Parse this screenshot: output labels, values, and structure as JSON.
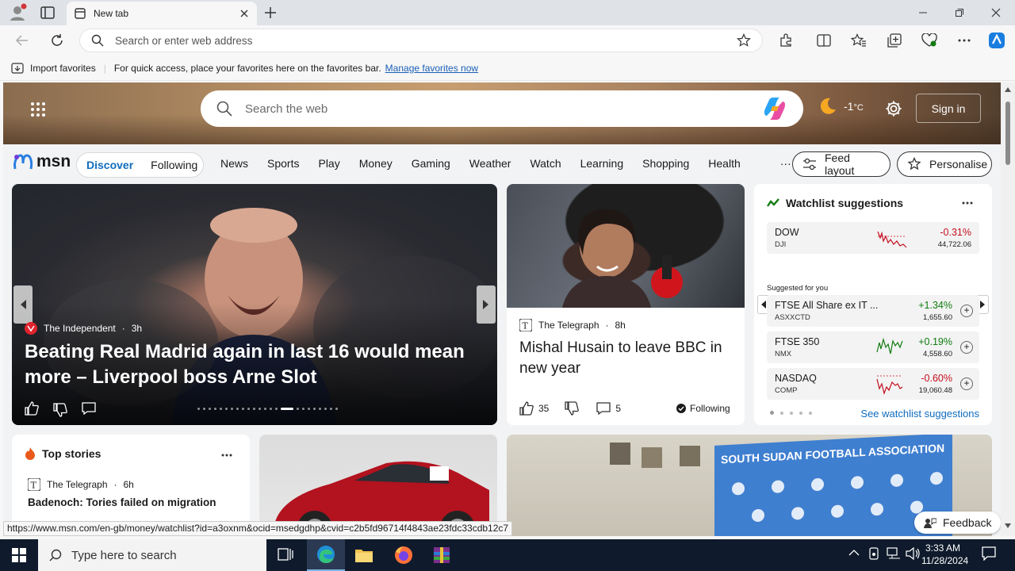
{
  "browser": {
    "tab_title": "New tab",
    "address_placeholder": "Search or enter web address",
    "favorites": {
      "import_label": "Import favorites",
      "hint_text": "For quick access, place your favorites here on the favorites bar.",
      "manage_link": "Manage favorites now"
    },
    "status_url": "https://www.msn.com/en-gb/money/watchlist?id=a3oxnm&ocid=msedgdhp&cvid=c2b5fd96714f4843ae23fdc33cdb12c7"
  },
  "msn": {
    "search_placeholder": "Search the web",
    "temperature": "-1",
    "temp_unit": "°C",
    "sign_in": "Sign in",
    "logo_text": "msn",
    "tabs": [
      "Discover",
      "Following"
    ],
    "nav": [
      "News",
      "Sports",
      "Play",
      "Money",
      "Gaming",
      "Weather",
      "Watch",
      "Learning",
      "Shopping",
      "Health"
    ],
    "more": "···",
    "feed_layout": "Feed layout",
    "personalise": "Personalise",
    "feedback": "Feedback"
  },
  "main_story": {
    "source": "The Independent",
    "age": "3h",
    "title": "Beating Real Madrid again in last 16 would mean more – Liverpool boss Arne Slot",
    "dots": 24,
    "active_dot": 15
  },
  "story2": {
    "source": "The Telegraph",
    "age": "8h",
    "title": "Mishal Husain to leave BBC in new year",
    "likes": "35",
    "comments": "5",
    "following": "Following"
  },
  "watchlist": {
    "title": "Watchlist suggestions",
    "main": {
      "name": "DOW",
      "symbol": "DJI",
      "change": "-0.31%",
      "price": "44,722.06"
    },
    "suggested_label": "Suggested for you",
    "suggested": [
      {
        "name": "FTSE All Share ex IT ...",
        "symbol": "ASXXCTD",
        "change": "+1.34%",
        "price": "1,655.60"
      },
      {
        "name": "FTSE 350",
        "symbol": "NMX",
        "change": "+0.19%",
        "price": "4,558.60"
      },
      {
        "name": "NASDAQ",
        "symbol": "COMP",
        "change": "-0.60%",
        "price": "19,060.48"
      }
    ],
    "see_link": "See watchlist suggestions"
  },
  "top_stories": {
    "title": "Top stories",
    "source": "The Telegraph",
    "age": "6h",
    "headline": "Badenoch: Tories failed on migration"
  },
  "ssfa_banner": "SOUTH SUDAN FOOTBALL ASSOCIATION",
  "taskbar": {
    "search_placeholder": "Type here to search",
    "time": "3:33 AM",
    "date": "11/28/2024"
  },
  "colors": {
    "accent": "#0f6cbd",
    "negative": "#c50f1f",
    "positive": "#0f7b0f",
    "taskbar": "#0f1b2c"
  }
}
